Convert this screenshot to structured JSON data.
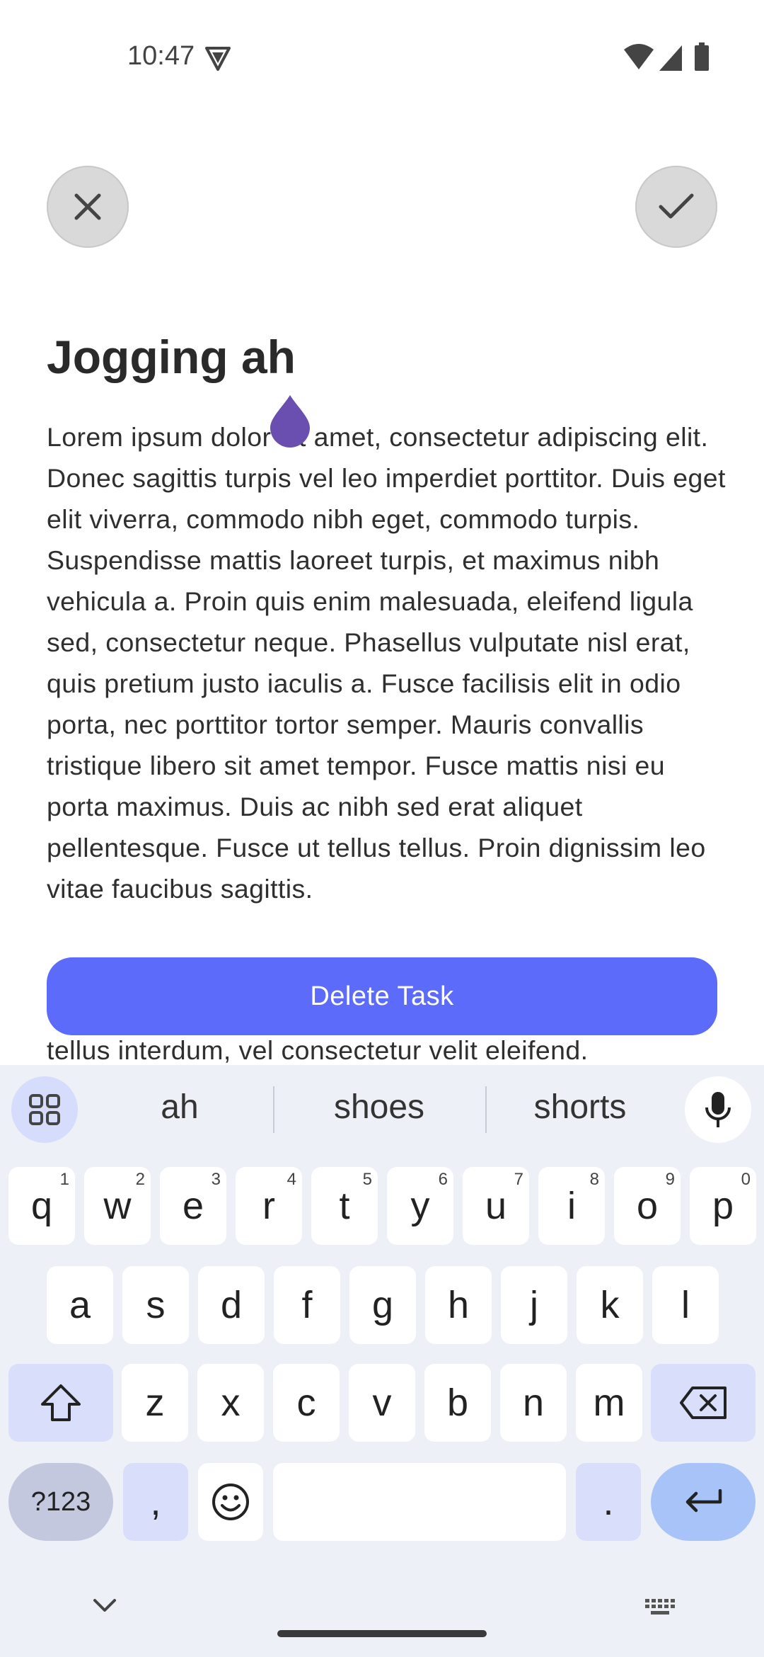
{
  "status": {
    "time": "10:47"
  },
  "task": {
    "title": "Jogging ah",
    "body": "Lorem ipsum dolor sit amet, consectetur adipiscing elit. Donec sagittis turpis vel leo imperdiet porttitor. Duis eget elit viverra, commodo nibh eget, commodo turpis. Suspendisse mattis laoreet turpis, et maximus nibh vehicula a. Proin quis enim malesuada, eleifend ligula sed, consectetur neque. Phasellus vulputate nisl erat, quis pretium justo iaculis a. Fusce facilisis elit in odio porta, nec porttitor tortor semper. Mauris convallis tristique libero sit amet tempor. Fusce mattis nisi eu porta maximus. Duis ac nibh sed erat aliquet pellentesque. Fusce ut tellus tellus. Proin dignissim leo vitae faucibus sagittis.",
    "tail": "tellus interdum, vel consectetur velit eleifend.",
    "delete_label": "Delete Task"
  },
  "keyboard": {
    "suggestions": [
      "ah",
      "shoes",
      "shorts"
    ],
    "row1": [
      {
        "k": "q",
        "h": "1"
      },
      {
        "k": "w",
        "h": "2"
      },
      {
        "k": "e",
        "h": "3"
      },
      {
        "k": "r",
        "h": "4"
      },
      {
        "k": "t",
        "h": "5"
      },
      {
        "k": "y",
        "h": "6"
      },
      {
        "k": "u",
        "h": "7"
      },
      {
        "k": "i",
        "h": "8"
      },
      {
        "k": "o",
        "h": "9"
      },
      {
        "k": "p",
        "h": "0"
      }
    ],
    "row2": [
      "a",
      "s",
      "d",
      "f",
      "g",
      "h",
      "j",
      "k",
      "l"
    ],
    "row3": [
      "z",
      "x",
      "c",
      "v",
      "b",
      "n",
      "m"
    ],
    "sym_label": "?123",
    "comma": ",",
    "period": "."
  },
  "colors": {
    "accent": "#5c6bfa",
    "cursor": "#6a4fb0"
  }
}
